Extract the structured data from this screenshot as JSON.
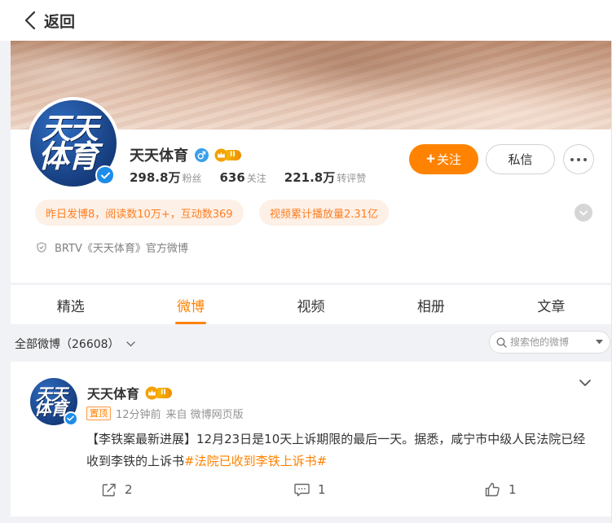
{
  "nav": {
    "back_label": "返回"
  },
  "profile": {
    "name": "天天体育",
    "avatar_text_top": "天天",
    "avatar_text_bottom": "体育",
    "level_badge": "II",
    "stats": [
      {
        "num": "298.8万",
        "label": "粉丝"
      },
      {
        "num": "636",
        "label": "关注"
      },
      {
        "num": "221.8万",
        "label": "转评赞"
      }
    ],
    "follow_label": "关注",
    "message_label": "私信",
    "chips": [
      "昨日发博8，阅读数10万+，互动数369",
      "视频累计播放量2.31亿"
    ],
    "official_text": "BRTV《天天体育》官方微博"
  },
  "tabs": [
    "精选",
    "微博",
    "视频",
    "相册",
    "文章"
  ],
  "active_tab": "微博",
  "filter": {
    "label": "全部微博（26608）",
    "search_placeholder": "搜索他的微博"
  },
  "post": {
    "author": "天天体育",
    "level_badge": "II",
    "top_tag": "置顶",
    "time": "12分钟前",
    "source": "来自 微博网页版",
    "text": "【李铁案最新进展】12月23日是10天上诉期限的最后一天。据悉，咸宁市中级人民法院已经收到李铁的上诉书",
    "hashtag": "#法院已收到李铁上诉书#",
    "repost_count": "2",
    "comment_count": "1",
    "like_count": "1"
  },
  "colors": {
    "accent": "#ff8200",
    "chip_bg": "#fdf0e6",
    "verified_blue": "#1c8de8",
    "page_bg": "#f1f2f5"
  },
  "icons": {
    "back": "chevron-left-icon",
    "gender": "male-icon",
    "crown": "crown-icon",
    "more": "more-dots-icon",
    "expand": "chevron-down-icon",
    "official": "shield-icon",
    "search": "search-icon",
    "repost": "repost-icon",
    "comment": "comment-icon",
    "like": "thumbs-up-icon"
  }
}
